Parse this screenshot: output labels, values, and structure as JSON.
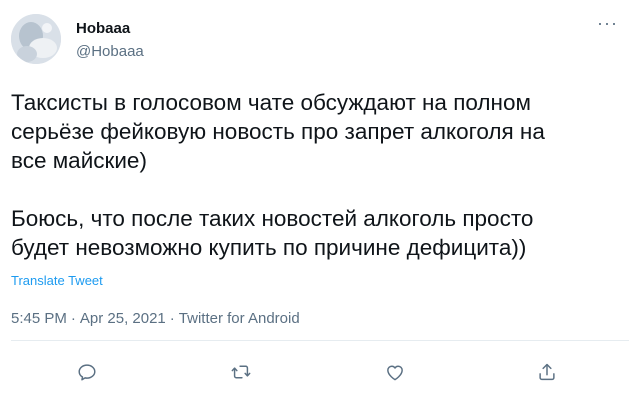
{
  "user": {
    "display_name": "Нobaaa",
    "handle": "@Hobaaa"
  },
  "more_label": "···",
  "tweet": {
    "paragraph_1": "Таксисты в голосовом чате обсуждают на полном\nсерьёзе фейковую новость про запрет алкоголя на\nвсе майские)",
    "paragraph_2": "Боюсь, что после таких новостей алкоголь просто\nбудет невозможно купить по причине дефицита))"
  },
  "translate_label": "Translate Tweet",
  "meta": {
    "time": "5:45 PM",
    "date": "Apr 25, 2021",
    "source": "Twitter for Android",
    "separator": "·"
  },
  "icons": {
    "reply": "reply-icon",
    "retweet": "retweet-icon",
    "like": "heart-icon",
    "share": "share-icon",
    "more": "more-icon"
  },
  "colors": {
    "text": "#0f1419",
    "secondary": "#5b7083",
    "link": "#1d9bf0",
    "divider": "#e6ecf0"
  }
}
